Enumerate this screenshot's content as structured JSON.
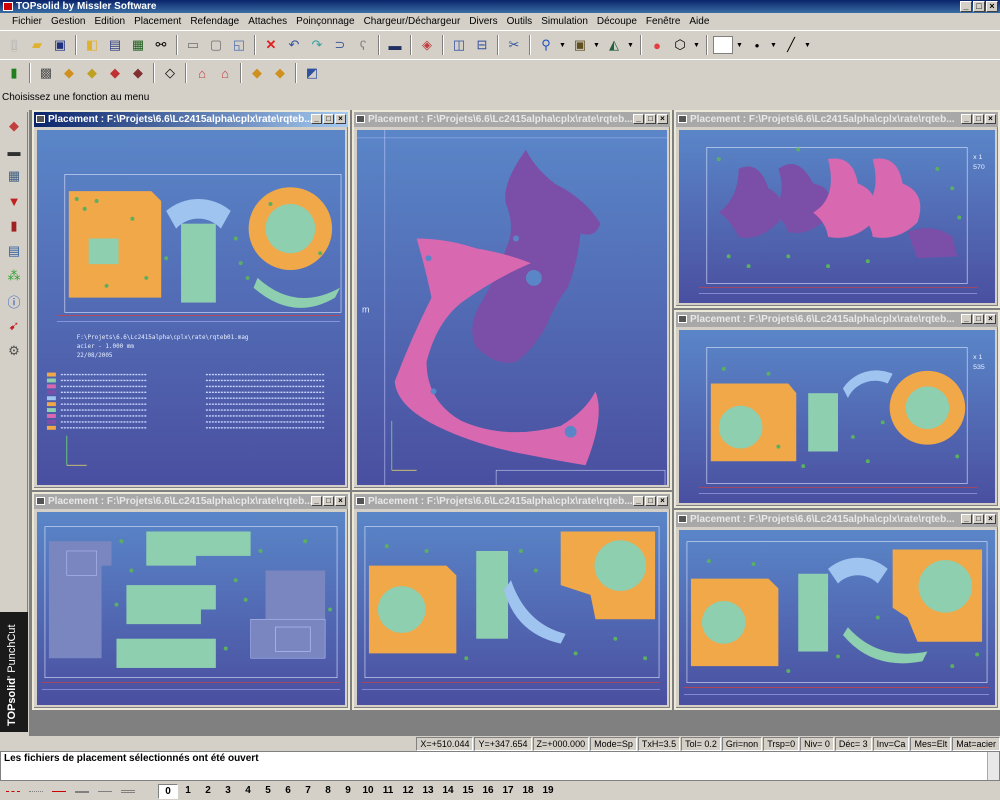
{
  "app": {
    "title": "TOPsolid by Missler Software"
  },
  "menu": [
    "Fichier",
    "Gestion",
    "Edition",
    "Placement",
    "Refendage",
    "Attaches",
    "Poinçonnage",
    "Chargeur/Déchargeur",
    "Divers",
    "Outils",
    "Simulation",
    "Découpe",
    "Fenêtre",
    "Aide"
  ],
  "hint": "Choisissez une fonction au menu",
  "windows": [
    {
      "title": "Placement : F:\\Projets\\6.6\\Lc2415alpha\\cplx\\rate\\rqteb...",
      "active": true
    },
    {
      "title": "Placement : F:\\Projets\\6.6\\Lc2415alpha\\cplx\\rate\\rqteb...",
      "active": false
    },
    {
      "title": "Placement : F:\\Projets\\6.6\\Lc2415alpha\\cplx\\rate\\rqteb...",
      "active": false
    },
    {
      "title": "Placement : F:\\Projets\\6.6\\Lc2415alpha\\cplx\\rate\\rqteb...",
      "active": false
    },
    {
      "title": "Placement : F:\\Projets\\6.6\\Lc2415alpha\\cplx\\rate\\rqteb...",
      "active": false
    },
    {
      "title": "Placement : F:\\Projets\\6.6\\Lc2415alpha\\cplx\\rate\\rqteb...",
      "active": false
    },
    {
      "title": "Placement : F:\\Projets\\6.6\\Lc2415alpha\\cplx\\rate\\rqteb...",
      "active": false
    }
  ],
  "report": {
    "path": "F:\\Projets\\6.6\\Lc2415alpha\\cplx\\rate\\rqteb01.mag",
    "material": "acier - 1.000 mm",
    "date": "22/08/2005"
  },
  "labels": {
    "m": "m",
    "x1": "x 1",
    "v570": "570",
    "v535": "535"
  },
  "status": {
    "x": "X=+510.044",
    "y": "Y=+347.654",
    "z": "Z=+000.000",
    "mode": "Mode=Sp",
    "txh": "TxH=3.5",
    "tol": "Tol=   0.2",
    "gri": "Gri=non",
    "trsp": "Trsp=0",
    "niv": "Niv= 0",
    "dec": "Déc= 3",
    "inv": "Inv=Ca",
    "mes": "Mes=Elt",
    "mat": "Mat=acier"
  },
  "message": "Les fichiers de placement sélectionnés ont été ouvert",
  "brand": {
    "bold": "TOPsolid",
    "rest": "' PunchCut"
  },
  "layers": [
    "0",
    "1",
    "2",
    "3",
    "4",
    "5",
    "6",
    "7",
    "8",
    "9",
    "10",
    "11",
    "12",
    "13",
    "14",
    "15",
    "16",
    "17",
    "18",
    "19"
  ],
  "colors": {
    "purple": "#7b4fa8",
    "pink": "#d868b0",
    "orange": "#f0a848",
    "teal": "#8ecfb0",
    "slate": "#7a86c0",
    "sky": "#a0c4f0"
  }
}
